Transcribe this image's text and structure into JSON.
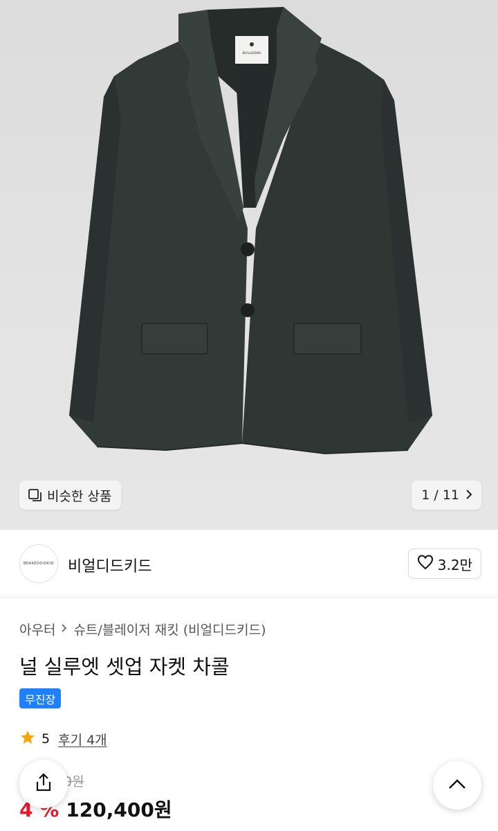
{
  "hero": {
    "label_tag_text": "BEALLDIDKID",
    "similar_button_label": "비슷한 상품",
    "page_counter": "1 / 11"
  },
  "brand": {
    "logo_text": "BEAKEDDIDKID",
    "name": "비얼디드키드",
    "likes": "3.2만"
  },
  "breadcrumb": {
    "items": [
      "아우터",
      "슈트/블레이저 재킷 (비얼디드키드)"
    ]
  },
  "product": {
    "title": "널 실루엣 셋업 자켓 차콜",
    "badge": "무진장",
    "rating": "5",
    "reviews": "후기 4개",
    "original_price": "0원",
    "discount": "4 %",
    "sale_price": "120,400원"
  },
  "colors": {
    "accent_blue": "#1e7fff",
    "sale_red": "#e8192c",
    "star": "#f5a60a",
    "jacket": "#2f3634"
  },
  "icons": {
    "similar": "similar-items-icon",
    "chevron": "chevron-right-icon",
    "heart": "heart-icon",
    "star": "star-icon",
    "share": "share-icon",
    "top": "chevron-up-icon"
  }
}
